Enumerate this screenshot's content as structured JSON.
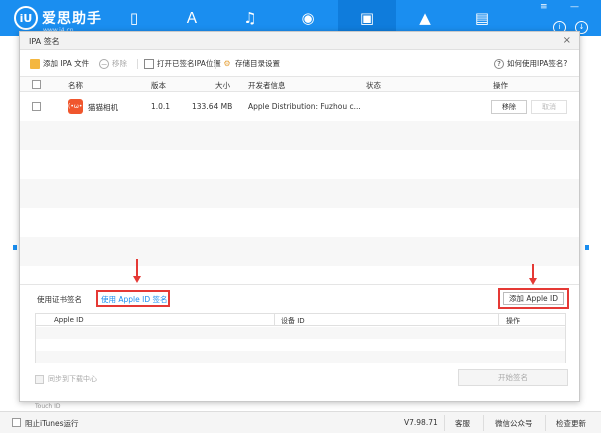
{
  "app": {
    "logo_mark": "iU",
    "logo_text": "爱思助手",
    "logo_url": "www.i4.cn"
  },
  "nav": {
    "items": [
      {
        "name": "device-icon",
        "glyph": "▯"
      },
      {
        "name": "appstore-icon",
        "glyph": "Ａ"
      },
      {
        "name": "music-icon",
        "glyph": "♫"
      },
      {
        "name": "photo-icon",
        "glyph": "◉"
      },
      {
        "name": "toolbox-icon",
        "glyph": "▣"
      },
      {
        "name": "education-icon",
        "glyph": "▲"
      },
      {
        "name": "storage-icon",
        "glyph": "▤"
      }
    ],
    "active_index": 4
  },
  "window_controls": {
    "info": "i",
    "download": "↓",
    "minimize": "—"
  },
  "dialog": {
    "title": "IPA 签名",
    "close": "×",
    "toolbar": {
      "add_ipa": "添加 IPA 文件",
      "remove": "移除",
      "open_signed": "打开已签名IPA位置",
      "storage_settings": "存储目录设置",
      "help": "如何使用IPA签名?"
    },
    "columns": {
      "name": "名称",
      "version": "版本",
      "size": "大小",
      "developer": "开发者信息",
      "status": "状态",
      "action": "操作"
    },
    "rows": [
      {
        "name": "猫猫相机",
        "icon_text": "(•ω•)",
        "version": "1.0.1",
        "size": "133.64 MB",
        "developer": "Apple Distribution: Fuzhou c...",
        "status": "",
        "remove_btn": "移除",
        "cancel_btn": "取消"
      }
    ],
    "sign": {
      "cert_label": "使用证书签名",
      "apple_id_tab": "使用 Apple ID 签名",
      "add_apple_id": "添加 Apple ID"
    },
    "id_columns": {
      "apple_id": "Apple ID",
      "device_id": "设备 ID",
      "action": "操作"
    },
    "sync_label": "同步到下载中心",
    "start_btn": "开始签名"
  },
  "background": {
    "peek_text": "Touch ID"
  },
  "footer": {
    "block_itunes": "阻止iTunes运行",
    "version": "V7.98.71",
    "support": "客服",
    "wechat": "微信公众号",
    "update": "检查更新"
  },
  "colors": {
    "primary": "#1a8ef0",
    "highlight": "#e53935"
  }
}
